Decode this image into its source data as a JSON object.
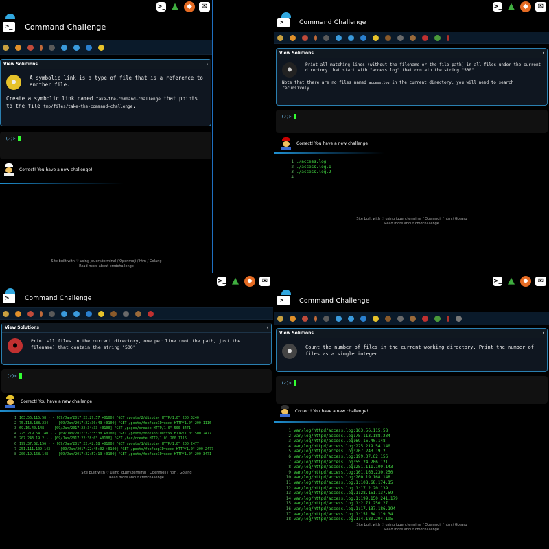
{
  "tiles": [
    {
      "title": "Command Challenge",
      "view_label": "View Solutions",
      "description": "A symbolic link is a type of file that is a reference to another file.",
      "task_prefix": "Create a symbolic link named",
      "task_code": "take-the-command-challenge",
      "task_middle": "that points to the file",
      "task_code2": "tmp/files/take-the-command-challenge",
      "task_suffix": ".",
      "prompt": "(✓)>",
      "correct": "Correct! You have a new challenge!",
      "footer_line1": "Site built with ♡ using jquery.terminal / Openmoji / htm / Golang",
      "footer_line2": "Read more about cmdchallenge"
    },
    {
      "title": "Command Challenge",
      "view_label": "View Solutions",
      "description": "Print all matching lines (without the filename or the file path) in all files under the current directory that start with \"access.log\" that contain the string \"500\".",
      "note_prefix": "Note that there are no files named",
      "note_code": "access.log",
      "note_suffix": "in the current directory, you will need to search recursively.",
      "prompt": "(✓)>",
      "correct": "Correct! You have a new challenge!",
      "output": [
        "./access.log",
        "./access.log.1",
        "./access.log.2",
        ""
      ],
      "footer_line1": "Site built with ♡ using jquery.terminal / Openmoji / htm / Golang",
      "footer_line2": "Read more about cmdchallenge"
    },
    {
      "title": "Command Challenge",
      "view_label": "View Solutions",
      "description": "Print all files in the current directory, one per line (not the path, just the filename) that contain the string \"500\".",
      "prompt": "(✓)>",
      "correct": "Correct! You have a new challenge!",
      "output": [
        "163.56.115.58 - - [09/Jan/2017:22:29:57 +0100] \"GET /posts/2/display HTTP/1.0\" 200 3240",
        "75.113.188.234 - - [09/Jan/2017:22:30:43 +0100] \"GET /posts/foo?appID=xxxx HTTP/1.0\" 200 1116",
        "69.16.40.148 - - [09/Jan/2017:22:34:33 +0100] \"GET /pages/create HTTP/1.0\" 500 3471",
        "225.219.54.140 - - [09/Jan/2017:22:35:30 +0100] \"GET /posts/foo?appID=xxxx HTTP/1.0\" 500 2477",
        "207.243.19.2 - - [09/Jan/2017:22:38:03 +0100] \"GET /bar/create HTTP/1.0\" 200 1116",
        "199.37.62.156 - - [09/Jan/2017:22:42:18 +0100] \"GET /posts/1/display HTTP/1.0\" 200 2477",
        "251.111.109.143 - - [09/Jan/2017:22:45:02 +0100] \"GET /posts/foo?appID=xxxx HTTP/1.0\" 200 2477",
        "200.19.168.148 - - [09/Jan/2017:22:57:13 +0100] \"GET /posts/foo?appID=xxxx HTTP/1.0\" 200 3471"
      ],
      "footer_line1": "Site built with ♡ using jquery.terminal / Openmoji / htm / Golang",
      "footer_line2": "Read more about cmdchallenge"
    },
    {
      "title": "Command Challenge",
      "view_label": "View Solutions",
      "description": "Count the number of files in the current working directory. Print the number of files as a single integer.",
      "prompt": "(✓)>",
      "correct": "Correct! You have a new challenge!",
      "output": [
        "var/log/httpd/access.log:163.56.115.58",
        "var/log/httpd/access.log:75.113.188.234",
        "var/log/httpd/access.log:69.16.40.148",
        "var/log/httpd/access.log:225.219.54.140",
        "var/log/httpd/access.log:207.243.19.2",
        "var/log/httpd/access.log:199.37.62.156",
        "var/log/httpd/access.log:55.24.206.121",
        "var/log/httpd/access.log:251.111.109.143",
        "var/log/httpd/access.log:101.163.230.250",
        "var/log/httpd/access.log:200.19.168.148",
        "var/log/httpd/access.log.1:108.68.174.15",
        "var/log/httpd/access.log.1:17.2.20.139",
        "var/log/httpd/access.log.1:28.151.137.59",
        "var/log/httpd/access.log.1:199.150.241.179",
        "var/log/httpd/access.log.1:2.71.250.27",
        "var/log/httpd/access.log.1:17.137.186.194",
        "var/log/httpd/access.log.1:151.84.119.34",
        "var/log/httpd/access.log.1:4.180.204.195"
      ],
      "footer_line1": "Site built with ♡ using jquery.terminal / Openmoji / htm / Golang",
      "footer_line2": "Read more about cmdchallenge"
    }
  ],
  "colors": {
    "accent": "#2a7fb0",
    "output_green": "#44dd44",
    "panel_bg": "#0f1620"
  }
}
